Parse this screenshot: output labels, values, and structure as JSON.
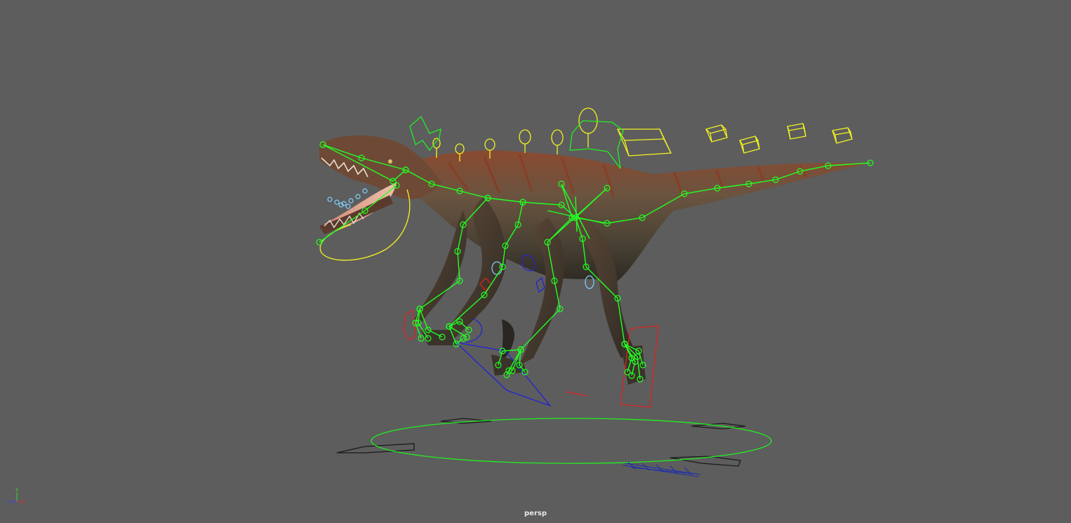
{
  "viewport": {
    "camera_label": "persp",
    "background_color": "#5d5d5d"
  },
  "axis_gizmo": {
    "x_label": "x",
    "y_label": "y",
    "z_label": "z",
    "x_color": "#e03030",
    "y_color": "#30e030",
    "z_color": "#4040ff"
  },
  "rig": {
    "subject": "raptor",
    "joint_color": "#22ff22",
    "control_colors": {
      "ik_green": "#22ff22",
      "fk_yellow": "#f2f222",
      "left_side_blue": "#1f1fd8",
      "right_side_red": "#dd2222",
      "face_cyan": "#7fd3ff"
    }
  }
}
